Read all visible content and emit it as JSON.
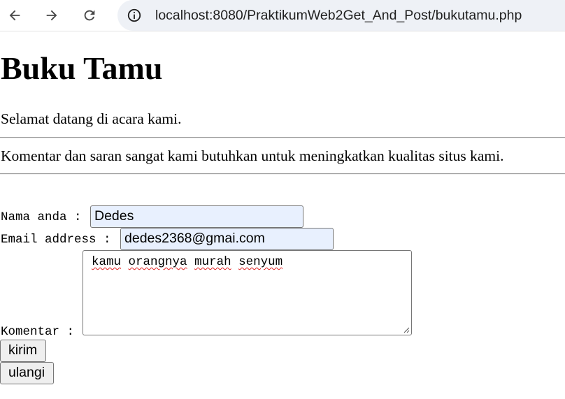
{
  "browser": {
    "url": "localhost:8080/PraktikumWeb2Get_And_Post/bukutamu.php",
    "icons": {
      "back": "arrow-left-icon",
      "forward": "arrow-right-icon",
      "reload": "reload-icon",
      "site_info": "info-icon"
    }
  },
  "page": {
    "title": "Buku Tamu",
    "welcome": "Selamat datang di acara kami.",
    "message": "Komentar dan saran sangat kami butuhkan untuk meningkatkan kualitas situs kami."
  },
  "form": {
    "nama_label": "Nama anda : ",
    "nama_value": "Dedes",
    "email_label": "Email address : ",
    "email_value": "dedes2368@gmai.com",
    "komentar_label": "Komentar : ",
    "komentar_words": [
      "kamu",
      "orangnya",
      "murah",
      "senyum"
    ],
    "submit_label": "kirim",
    "reset_label": "ulangi"
  },
  "colors": {
    "autofill_bg": "#e8f0fe",
    "button_bg": "#efefef",
    "spellcheck_underline": "#e02020"
  }
}
